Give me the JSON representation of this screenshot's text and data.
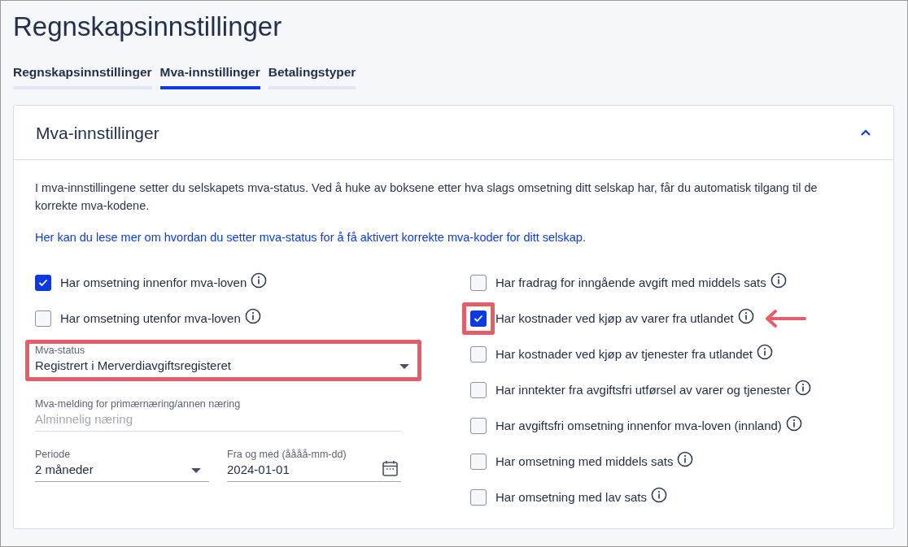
{
  "page_title": "Regnskapsinnstillinger",
  "tabs": [
    {
      "label": "Regnskapsinnstillinger",
      "selected": false
    },
    {
      "label": "Mva-innstillinger",
      "selected": true
    },
    {
      "label": "Betalingstyper",
      "selected": false
    }
  ],
  "panel": {
    "title": "Mva-innstillinger",
    "expanded": true,
    "intro": "I mva-innstillingene setter du selskapets mva-status. Ved å huke av boksene etter hva slags omsetning ditt selskap har, får du automatisk tilgang til de korrekte mva-kodene.",
    "link": "Her kan du lese mer om hvordan du setter mva-status for å få aktivert korrekte mva-koder for ditt selskap.",
    "left_checks": [
      {
        "label": "Har omsetning innenfor mva-loven",
        "checked": true,
        "highlighted": false,
        "arrow": false
      },
      {
        "label": "Har omsetning utenfor mva-loven",
        "checked": false,
        "highlighted": false,
        "arrow": false
      }
    ],
    "status_select": {
      "label": "Mva-status",
      "value": "Registrert i Merverdiavgiftsregisteret",
      "highlighted": true
    },
    "report_field": {
      "label": "Mva-melding for primærnæring/annen næring",
      "value": "Alminnelig næring",
      "disabled": true
    },
    "period_select": {
      "label": "Periode",
      "value": "2 måneder"
    },
    "date_field": {
      "label": "Fra og med (åååå-mm-dd)",
      "value": "2024-01-01"
    },
    "right_checks": [
      {
        "label": "Har fradrag for inngående avgift med middels sats",
        "checked": false,
        "highlighted": false,
        "arrow": false
      },
      {
        "label": "Har kostnader ved kjøp av varer fra utlandet",
        "checked": true,
        "highlighted": true,
        "arrow": true
      },
      {
        "label": "Har kostnader ved kjøp av tjenester fra utlandet",
        "checked": false,
        "highlighted": false,
        "arrow": false
      },
      {
        "label": "Har inntekter fra avgiftsfri utførsel av varer og tjenester",
        "checked": false,
        "highlighted": false,
        "arrow": false
      },
      {
        "label": "Har avgiftsfri omsetning innenfor mva-loven (innland)",
        "checked": false,
        "highlighted": false,
        "arrow": false
      },
      {
        "label": "Har omsetning med middels sats",
        "checked": false,
        "highlighted": false,
        "arrow": false
      },
      {
        "label": "Har omsetning med lav sats",
        "checked": false,
        "highlighted": false,
        "arrow": false
      }
    ]
  }
}
